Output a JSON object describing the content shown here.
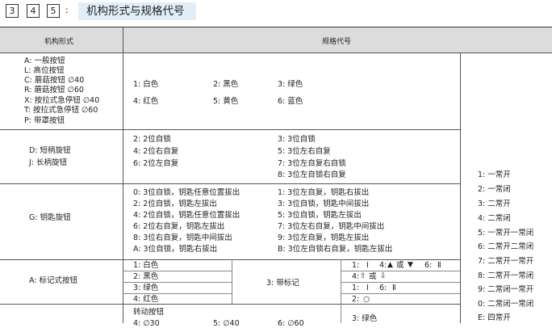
{
  "header": {
    "nums": [
      "3",
      "4",
      "5"
    ],
    "colon": ":",
    "title": "机构形式与规格代号"
  },
  "table_head": {
    "col1": "机构形式",
    "col2": "规格代号"
  },
  "sec1": {
    "forms": [
      "A: 一般按钮",
      "L: 高位按钮",
      "C: 蘑菇按钮 ∅40",
      "R: 蘑菇按钮 ∅60",
      "X: 按拉式急停钮 ∅40",
      "T: 按拉式急停钮 ∅60",
      "P: 带罩按钮"
    ],
    "colors": [
      "1: 白色",
      "2: 黑色",
      "3: 绿色",
      "4: 红色",
      "5: 黄色",
      "6: 蓝色"
    ]
  },
  "sec2": {
    "forms": [
      "D: 短柄旋钮",
      "J: 长柄旋钮"
    ],
    "specs": [
      "2: 2位自锁",
      "3: 3位自锁",
      "4: 2位右自复",
      "5: 3位左右自复",
      "6: 2位左自复",
      "7: 3位左自复右自锁",
      "8: 3位左自锁右自复"
    ]
  },
  "sec3": {
    "form": "G: 钥匙旋钮",
    "specs": [
      "0: 3位自锁，钥匙任意位置拔出",
      "1: 3位左自复，钥匙右拔出",
      "2: 2位自锁，钥匙左拔出",
      "3: 3位自锁，钥匙中间拔出",
      "4: 2位自锁，钥匙任意位置拔出",
      "5: 3位自锁，钥匙左拔出",
      "6: 2位右自复，钥匙左拔出",
      "7: 3位左右自复，钥匙中间拔出",
      "8: 3位右自复，钥匙中间拔出",
      "9: 3位左自复，钥匙左拔出",
      "A: 3位自锁，钥匙右拔出",
      "B: 3位左自锁右自复，钥匙左拔出"
    ]
  },
  "sec4": {
    "form": "A: 标记式按钮",
    "colors": [
      "1: 白色",
      "2: 黑色",
      "3: 绿色",
      "4: 红色"
    ],
    "mark": "3: 带标记",
    "marks": {
      "r1_a": "1:",
      "r1_b": "4:",
      "r1_or": "或",
      "r1_c": "6:",
      "r2_a": "4:",
      "r2_or": "或",
      "r3_a": "1:",
      "r3_b": "6:",
      "r4_a": "2:"
    }
  },
  "sec5": {
    "label": "转动按钮",
    "items": [
      "4: ∅30",
      "5: ∅40",
      "6: ∅60"
    ],
    "color": "3: 绿色"
  },
  "contacts": [
    "1: 一常开",
    "2: 一常闭",
    "3: 二常开",
    "4: 二常闭",
    "5: 一常开一常闭",
    "6: 二常开二常闭",
    "7: 二常开一常开",
    "8: 二常开一常闭",
    "9: 二常闭一常开",
    "0: 二常闭一常闭",
    "E: 四常开"
  ]
}
